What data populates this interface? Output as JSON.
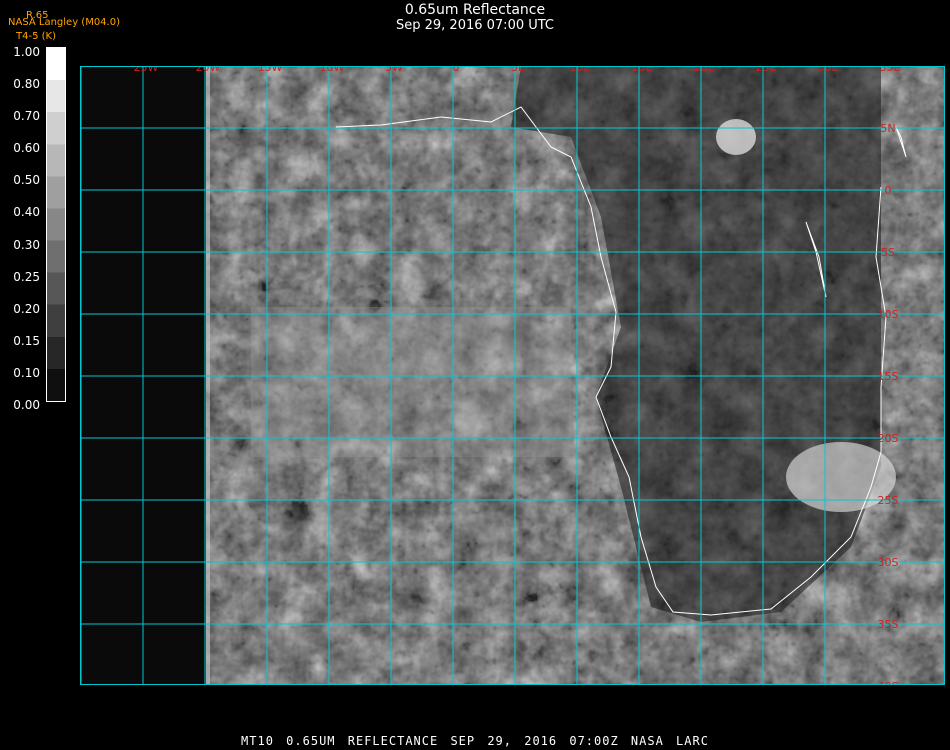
{
  "header": {
    "title": "0.65um Reflectance",
    "subtitle": "Sep 29, 2016 07:00 UTC",
    "institution": "NASA Langley (M04.0)",
    "colorbar_var": "R.65",
    "colorbar_sub": "T4-5 (K)"
  },
  "colorbar": {
    "ticks": [
      "1.00",
      "0.80",
      "0.70",
      "0.60",
      "0.50",
      "0.40",
      "0.30",
      "0.25",
      "0.20",
      "0.15",
      "0.10",
      "0.00"
    ]
  },
  "grid": {
    "lon_labels": [
      "25W",
      "20W",
      "15W",
      "10W",
      "5W",
      "0",
      "5E",
      "10E",
      "15E",
      "20E",
      "25E",
      "30E",
      "35E"
    ],
    "lat_labels": [
      "5N",
      "0",
      "5S",
      "10S",
      "15S",
      "20S",
      "25S",
      "30S",
      "35S",
      "40S"
    ],
    "line_color": "#00c8d0",
    "label_color": "#cc2222"
  },
  "footer": {
    "text": "MT10  0.65UM REFLECTANCE   SEP 29, 2016 07:00Z   NASA LARC"
  }
}
